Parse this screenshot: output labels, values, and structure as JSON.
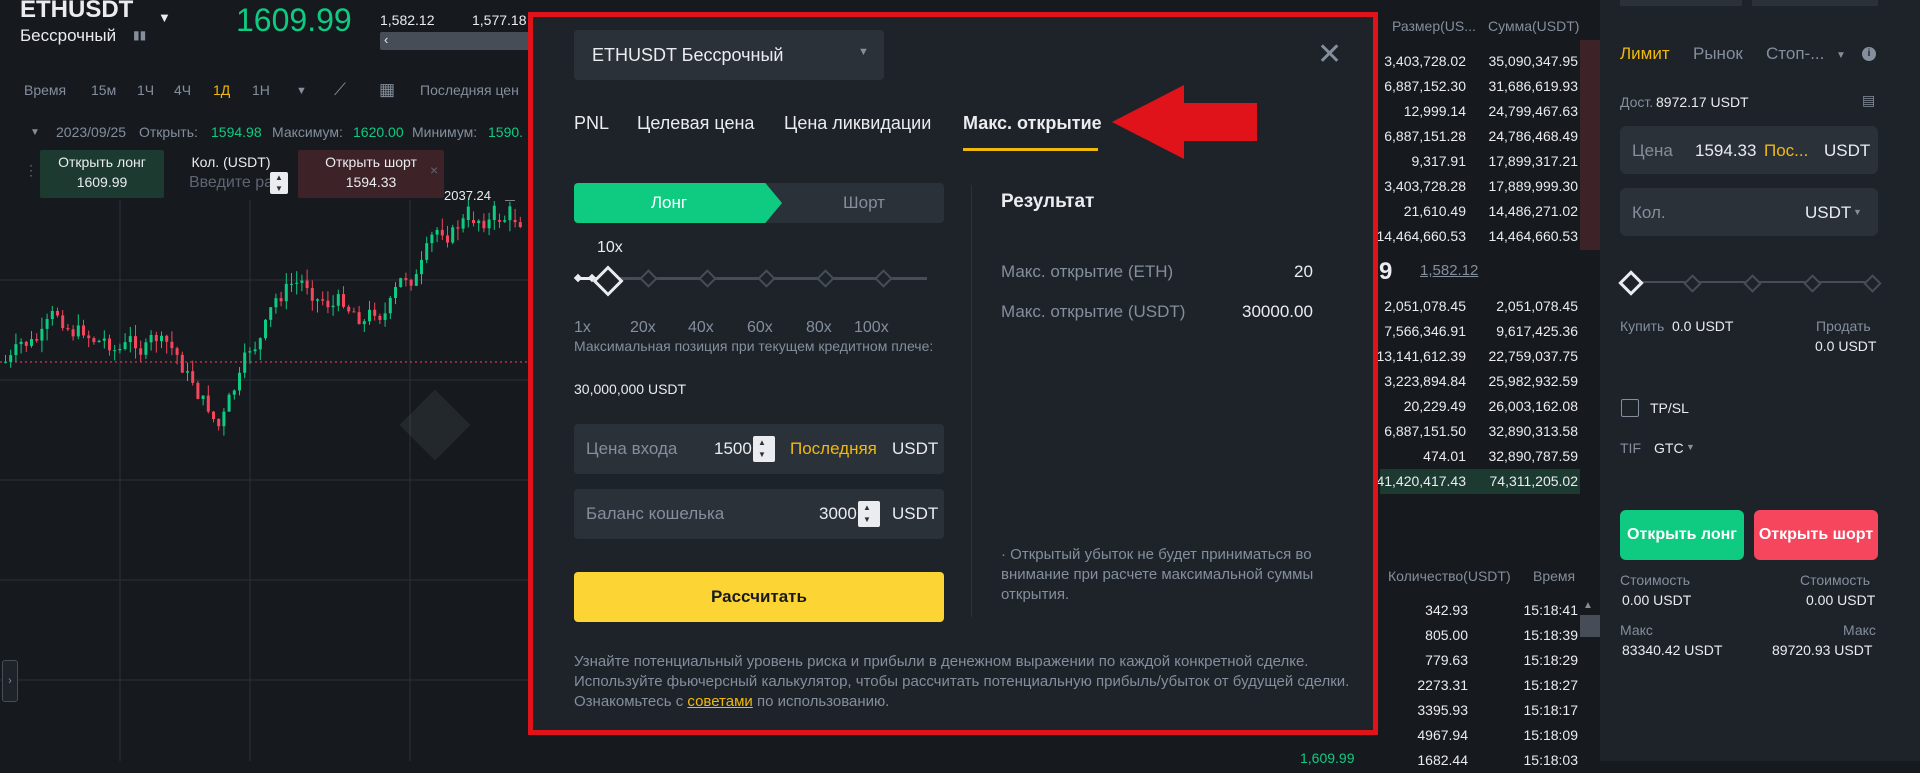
{
  "header": {
    "symbol": "ETHUSDT",
    "contract_type": "Бессрочный",
    "last_price": "1609.99",
    "mark_price": "1,582.12",
    "index_price": "1,577.18"
  },
  "chart_toolbar": {
    "intervals": [
      "Время",
      "15м",
      "1Ч",
      "4Ч",
      "1Д",
      "1Н"
    ],
    "active_interval": "1Д",
    "price_source": "Последняя цен"
  },
  "chart": {
    "ohlc_date": "2023/09/25",
    "open_label": "Открыть:",
    "open_value": "1594.98",
    "max_label": "Максимум:",
    "max_value": "1620.00",
    "min_label": "Минимум:",
    "min_value": "1590.",
    "high_marker": "2037.24"
  },
  "quick_trade": {
    "long_label": "Открыть лонг",
    "long_price": "1609.99",
    "qty_label": "Кол. (USDT)",
    "qty_placeholder": "Введите ра",
    "short_label": "Открыть шорт",
    "short_price": "1594.33"
  },
  "orderbook": {
    "col_size": "Размер(US...",
    "col_sum": "Сумма(USDT)",
    "asks": [
      {
        "size": "3,403,728.02",
        "sum": "35,090,347.95"
      },
      {
        "size": "6,887,152.30",
        "sum": "31,686,619.93"
      },
      {
        "size": "12,999.14",
        "sum": "24,799,467.63"
      },
      {
        "size": "6,887,151.28",
        "sum": "24,786,468.49"
      },
      {
        "size": "9,317.91",
        "sum": "17,899,317.21"
      },
      {
        "size": "3,403,728.28",
        "sum": "17,889,999.30"
      },
      {
        "size": "21,610.49",
        "sum": "14,486,271.02"
      },
      {
        "size": "14,464,660.53",
        "sum": "14,464,660.53"
      }
    ],
    "mid_price": "9",
    "mid_mark": "1,582.12",
    "bids": [
      {
        "size": "2,051,078.45",
        "sum": "2,051,078.45"
      },
      {
        "size": "7,566,346.91",
        "sum": "9,617,425.36"
      },
      {
        "size": "13,141,612.39",
        "sum": "22,759,037.75"
      },
      {
        "size": "3,223,894.84",
        "sum": "25,982,932.59"
      },
      {
        "size": "20,229.49",
        "sum": "26,003,162.08"
      },
      {
        "size": "6,887,151.50",
        "sum": "32,890,313.58"
      },
      {
        "size": "474.01",
        "sum": "32,890,787.59"
      },
      {
        "size": "41,420,417.43",
        "sum": "74,311,205.02"
      }
    ]
  },
  "trades": {
    "col_qty": "Количество(USDT)",
    "col_time": "Время",
    "rows": [
      {
        "qty": "342.93",
        "time": "15:18:41"
      },
      {
        "qty": "805.00",
        "time": "15:18:39"
      },
      {
        "qty": "779.63",
        "time": "15:18:29"
      },
      {
        "qty": "2273.31",
        "time": "15:18:27"
      },
      {
        "qty": "3395.93",
        "time": "15:18:17"
      },
      {
        "qty": "4967.94",
        "time": "15:18:09"
      },
      {
        "qty": "1682.44",
        "time": "15:18:03"
      }
    ],
    "bottom_price": "1,609.99"
  },
  "trade_panel": {
    "tab_limit": "Лимит",
    "tab_market": "Рынок",
    "tab_stop": "Стоп-...",
    "available_label": "Дост.",
    "available_value": "8972.17 USDT",
    "price_label": "Цена",
    "price_value": "1594.33",
    "price_last": "Пос...",
    "price_unit": "USDT",
    "qty_label": "Кол.",
    "qty_unit": "USDT",
    "buy_label": "Купить",
    "buy_value": "0.0 USDT",
    "sell_label": "Продать",
    "sell_value": "0.0 USDT",
    "tpsl_label": "TP/SL",
    "tif_label": "TIF",
    "tif_value": "GTC",
    "open_long": "Открыть лонг",
    "open_short": "Открыть шорт",
    "cost_label": "Стоимость",
    "cost_long": "0.00 USDT",
    "cost_short": "0.00 USDT",
    "max_label": "Макс",
    "max_long": "83340.42 USDT",
    "max_short": "89720.93 USDT"
  },
  "modal": {
    "contract_select": "ETHUSDT Бессрочный",
    "tabs": [
      "PNL",
      "Целевая цена",
      "Цена ликвидации",
      "Макс. открытие"
    ],
    "active_tab": "Макс. открытие",
    "long_label": "Лонг",
    "short_label": "Шорт",
    "leverage_value": "10x",
    "leverage_fraction": 0.09,
    "leverage_ticks": [
      "1x",
      "20x",
      "40x",
      "60x",
      "80x",
      "100x"
    ],
    "max_position_note": "Максимальная позиция при текущем кредитном плече:",
    "max_position_value": "30,000,000 USDT",
    "entry_price_label": "Цена входа",
    "entry_price_value": "1500",
    "entry_price_last": "Последняя",
    "entry_price_unit": "USDT",
    "wallet_label": "Баланс кошелька",
    "wallet_value": "3000",
    "wallet_unit": "USDT",
    "calculate_button": "Рассчитать",
    "result_title": "Результат",
    "result_eth_label": "Макс. открытие (ETH)",
    "result_eth_value": "20",
    "result_usdt_label": "Макс. открытие (USDT)",
    "result_usdt_value": "30000.00",
    "result_note": "· Открытый убыток не будет приниматься во внимание при расчете максимальной суммы открытия.",
    "footer_text_1": "Узнайте потенциальный уровень риска и прибыли в денежном выражении по каждой конкретной сделке. Используйте фьючерсный калькулятор, чтобы рассчитать потенциальную прибыль/убыток от будущей сделки. Ознакомьтесь с",
    "footer_link": "советами",
    "footer_text_2": "по использованию."
  },
  "colors": {
    "green": "#0ecb81",
    "red": "#f6465d",
    "yellow": "#f0b90b",
    "button_yellow": "#fcd535",
    "annotation_red": "#e0131a"
  }
}
